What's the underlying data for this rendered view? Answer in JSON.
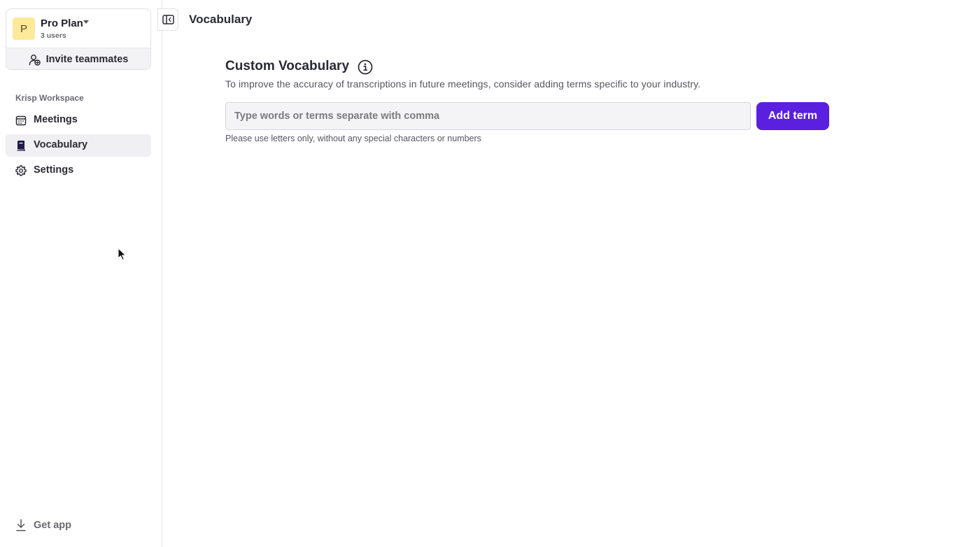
{
  "sidebar": {
    "plan": {
      "avatar_letter": "P",
      "name": "Pro Plan",
      "users": "3 users",
      "avatar_color": "#fde99a"
    },
    "invite_label": "Invite teammates",
    "workspace_label": "Krisp Workspace",
    "items": [
      {
        "label": "Meetings",
        "icon": "calendar-icon",
        "active": false
      },
      {
        "label": "Vocabulary",
        "icon": "book-icon",
        "active": true
      },
      {
        "label": "Settings",
        "icon": "gear-icon",
        "active": false
      }
    ],
    "get_app_label": "Get app"
  },
  "header": {
    "title": "Vocabulary"
  },
  "main": {
    "section_title": "Custom Vocabulary",
    "description": "To improve the accuracy of transcriptions in future meetings, consider adding terms specific to your industry.",
    "input": {
      "value": "",
      "placeholder": "Type words or terms separate with comma"
    },
    "add_button_label": "Add term",
    "hint": "Please use letters only, without any special characters or numbers"
  },
  "colors": {
    "accent": "#5b1fe0",
    "active_bg": "#f0f0f3"
  }
}
